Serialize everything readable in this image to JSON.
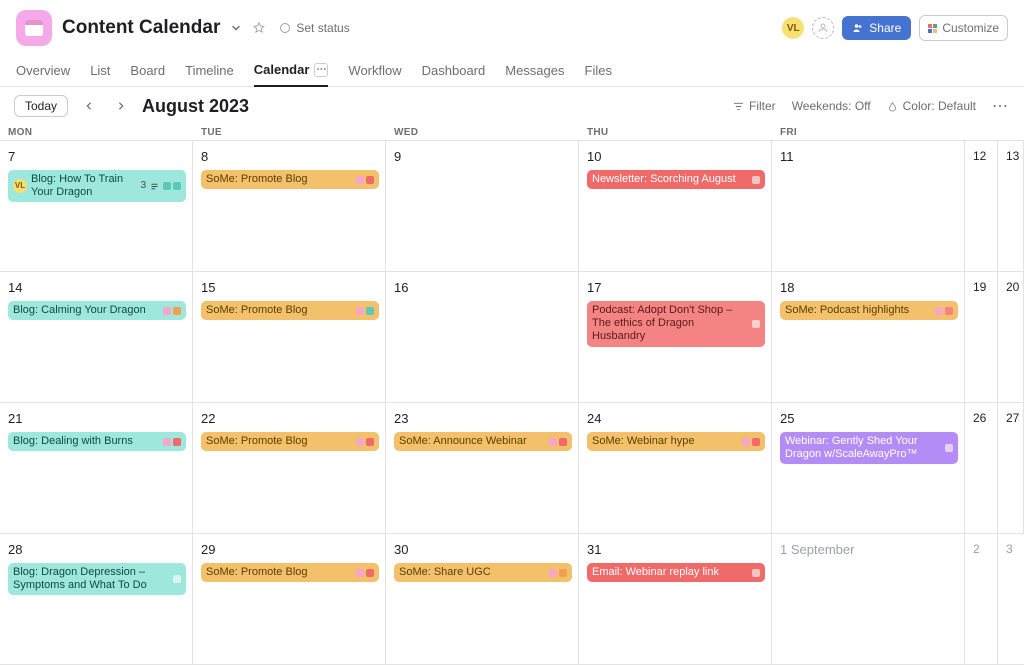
{
  "header": {
    "title": "Content Calendar",
    "set_status": "Set status",
    "avatar1": "VL",
    "share": "Share",
    "customize": "Customize"
  },
  "tabs": [
    "Overview",
    "List",
    "Board",
    "Timeline",
    "Calendar",
    "Workflow",
    "Dashboard",
    "Messages",
    "Files"
  ],
  "tabs_active": "Calendar",
  "toolbar": {
    "today": "Today",
    "month": "August 2023",
    "filter": "Filter",
    "weekends": "Weekends: Off",
    "color": "Color: Default"
  },
  "day_headers": [
    "MON",
    "TUE",
    "WED",
    "THU",
    "FRI"
  ],
  "weeks": [
    {
      "days": [
        {
          "date": "7",
          "tasks": [
            {
              "title": "Blog: How To Train Your Dragon",
              "color": "teal",
              "avatar": "VL",
              "count": "3",
              "chips": [
                "teal",
                "teal"
              ]
            }
          ]
        },
        {
          "date": "8",
          "tasks": [
            {
              "title": "SoMe: Promote Blog",
              "color": "orange",
              "chips": [
                "pink",
                "red"
              ]
            }
          ]
        },
        {
          "date": "9",
          "tasks": []
        },
        {
          "date": "10",
          "tasks": [
            {
              "title": "Newsletter: Scorching August",
              "color": "red",
              "chips": [
                "callout"
              ]
            }
          ]
        },
        {
          "date": "11",
          "tasks": []
        },
        {
          "date": "12",
          "weekend": true
        },
        {
          "date": "13",
          "weekend": true
        }
      ]
    },
    {
      "days": [
        {
          "date": "14",
          "tasks": [
            {
              "title": "Blog: Calming Your Dragon",
              "color": "teal",
              "chips": [
                "pink",
                "orange"
              ]
            }
          ]
        },
        {
          "date": "15",
          "tasks": [
            {
              "title": "SoMe: Promote Blog",
              "color": "orange",
              "chips": [
                "pink",
                "teal"
              ]
            }
          ]
        },
        {
          "date": "16",
          "tasks": []
        },
        {
          "date": "17",
          "tasks": [
            {
              "title": "Podcast: Adopt Don't Shop – The ethics of Dragon Husbandry",
              "color": "salmon",
              "chips": [
                "callout"
              ]
            }
          ]
        },
        {
          "date": "18",
          "tasks": [
            {
              "title": "SoMe: Podcast highlights",
              "color": "orange",
              "chips": [
                "pink",
                "salmon"
              ]
            }
          ]
        },
        {
          "date": "19",
          "weekend": true
        },
        {
          "date": "20",
          "weekend": true
        }
      ]
    },
    {
      "days": [
        {
          "date": "21",
          "tasks": [
            {
              "title": "Blog: Dealing with Burns",
              "color": "teal",
              "chips": [
                "pink",
                "red"
              ]
            }
          ]
        },
        {
          "date": "22",
          "tasks": [
            {
              "title": "SoMe: Promote Blog",
              "color": "orange",
              "chips": [
                "pink",
                "red"
              ]
            }
          ]
        },
        {
          "date": "23",
          "tasks": [
            {
              "title": "SoMe: Announce Webinar",
              "color": "orange",
              "chips": [
                "pink",
                "red"
              ]
            }
          ]
        },
        {
          "date": "24",
          "tasks": [
            {
              "title": "SoMe: Webinar hype",
              "color": "orange",
              "chips": [
                "pink",
                "red"
              ]
            }
          ]
        },
        {
          "date": "25",
          "tasks": [
            {
              "title": "Webinar: Gently Shed Your Dragon w/ScaleAwayPro™",
              "color": "purple",
              "chips": [
                "callout"
              ]
            }
          ]
        },
        {
          "date": "26",
          "weekend": true
        },
        {
          "date": "27",
          "weekend": true
        }
      ]
    },
    {
      "days": [
        {
          "date": "28",
          "tasks": [
            {
              "title": "Blog: Dragon Depression – Symptoms and What To Do",
              "color": "teal",
              "chips": [
                "callout"
              ]
            }
          ]
        },
        {
          "date": "29",
          "tasks": [
            {
              "title": "SoMe: Promote Blog",
              "color": "orange",
              "chips": [
                "pink",
                "red"
              ]
            }
          ]
        },
        {
          "date": "30",
          "tasks": [
            {
              "title": "SoMe: Share UGC",
              "color": "orange",
              "chips": [
                "pink",
                "orange"
              ]
            }
          ]
        },
        {
          "date": "31",
          "tasks": [
            {
              "title": "Email: Webinar replay link",
              "color": "red",
              "chips": [
                "callout"
              ]
            }
          ]
        },
        {
          "date": "1 September",
          "muted": true,
          "tasks": []
        },
        {
          "date": "2",
          "weekend": true,
          "muted": true
        },
        {
          "date": "3",
          "weekend": true,
          "muted": true
        }
      ]
    }
  ]
}
